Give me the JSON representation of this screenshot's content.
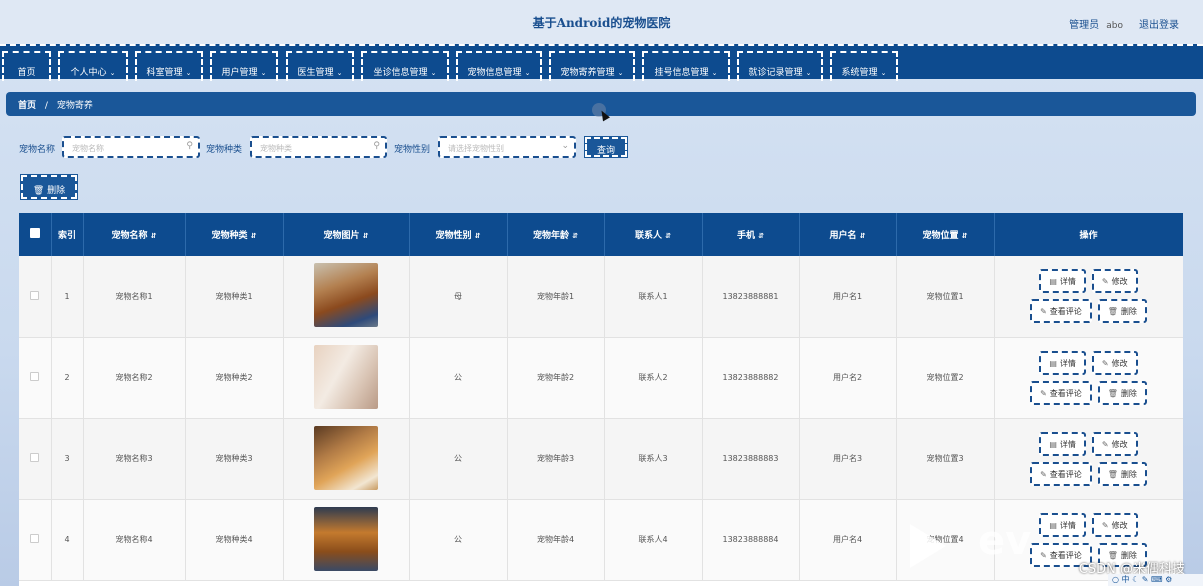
{
  "header": {
    "title": "基于Android的宠物医院",
    "role_label": "管理员",
    "username": "abo",
    "logout_label": "退出登录"
  },
  "nav": {
    "items": [
      {
        "label": "首页",
        "has_dropdown": false
      },
      {
        "label": "个人中心",
        "has_dropdown": true
      },
      {
        "label": "科室管理",
        "has_dropdown": true
      },
      {
        "label": "用户管理",
        "has_dropdown": true
      },
      {
        "label": "医生管理",
        "has_dropdown": true
      },
      {
        "label": "坐诊信息管理",
        "has_dropdown": true
      },
      {
        "label": "宠物信息管理",
        "has_dropdown": true
      },
      {
        "label": "宠物寄养管理",
        "has_dropdown": true
      },
      {
        "label": "挂号信息管理",
        "has_dropdown": true
      },
      {
        "label": "就诊记录管理",
        "has_dropdown": true
      },
      {
        "label": "系统管理",
        "has_dropdown": true
      }
    ]
  },
  "breadcrumb": {
    "home": "首页",
    "separator": "/",
    "current": "宠物寄养"
  },
  "search": {
    "name_label": "宠物名称",
    "name_placeholder": "宠物名称",
    "type_label": "宠物种类",
    "type_placeholder": "宠物种类",
    "gender_label": "宠物性别",
    "gender_placeholder": "请选择宠物性别",
    "query_label": "查询"
  },
  "toolbar": {
    "delete_label": "删除"
  },
  "table": {
    "columns": [
      "索引",
      "宠物名称",
      "宠物种类",
      "宠物图片",
      "宠物性别",
      "宠物年龄",
      "联系人",
      "手机",
      "用户名",
      "宠物位置",
      "操作"
    ],
    "rows": [
      {
        "index": "1",
        "name": "宠物名称1",
        "type": "宠物种类1",
        "image": "dog1",
        "gender": "母",
        "age": "宠物年龄1",
        "contact": "联系人1",
        "phone": "13823888881",
        "username": "用户名1",
        "location": "宠物位置1"
      },
      {
        "index": "2",
        "name": "宠物名称2",
        "type": "宠物种类2",
        "image": "cat",
        "gender": "公",
        "age": "宠物年龄2",
        "contact": "联系人2",
        "phone": "13823888882",
        "username": "用户名2",
        "location": "宠物位置2"
      },
      {
        "index": "3",
        "name": "宠物名称3",
        "type": "宠物种类3",
        "image": "shiba",
        "gender": "公",
        "age": "宠物年龄3",
        "contact": "联系人3",
        "phone": "13823888883",
        "username": "用户名3",
        "location": "宠物位置3"
      },
      {
        "index": "4",
        "name": "宠物名称4",
        "type": "宠物种类4",
        "image": "dog4",
        "gender": "公",
        "age": "宠物年龄4",
        "contact": "联系人4",
        "phone": "13823888884",
        "username": "用户名4",
        "location": "宠物位置4"
      }
    ],
    "actions": {
      "detail": "详情",
      "edit": "修改",
      "view_comments": "查看评论",
      "delete": "删除"
    }
  },
  "watermark": {
    "text": "CSDN @米偶科技"
  },
  "colors": {
    "primary": "#0d4b8f",
    "accent": "#1a5799",
    "background": "#d6e3f3"
  }
}
